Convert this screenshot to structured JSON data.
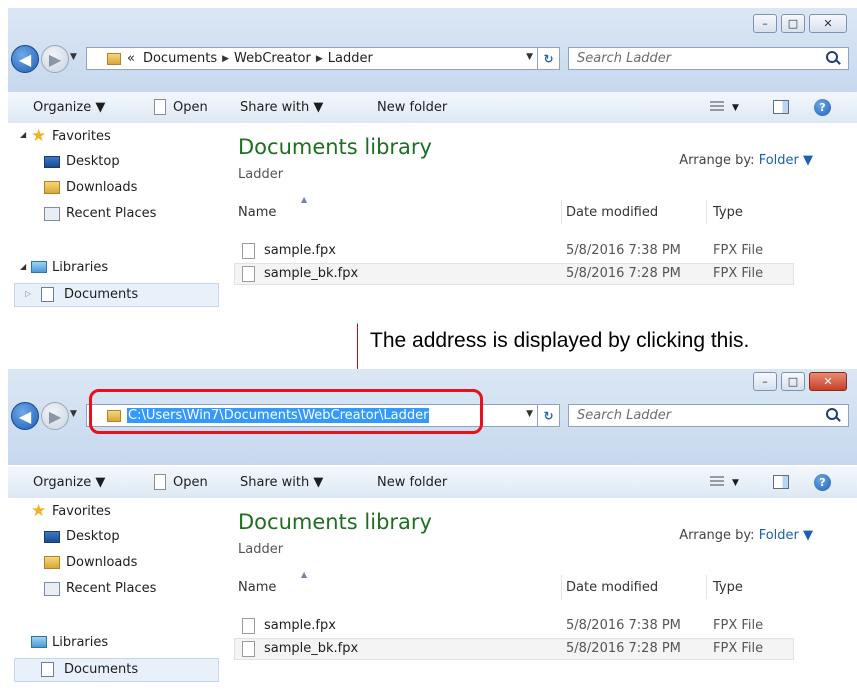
{
  "explorer": {
    "window_controls": {
      "minimize": "–",
      "maximize": "□",
      "close": "✕"
    },
    "nav": {
      "back": "◀",
      "forward": "▶",
      "dropdown": "▼"
    },
    "address": {
      "breadcrumb_prefix": "«",
      "breadcrumb": [
        "Documents",
        "WebCreator",
        "Ladder"
      ],
      "separator": "▶",
      "full_path": "C:\\Users\\Win7\\Documents\\WebCreator\\Ladder",
      "dropdown": "▼",
      "refresh": "↻"
    },
    "search": {
      "placeholder": "Search Ladder"
    },
    "toolbar": {
      "organize": "Organize ▼",
      "open": "Open",
      "share_with": "Share with ▼",
      "new_folder": "New folder",
      "views_dropdown": "▼",
      "help": "?"
    },
    "nav_pane": {
      "favorites": "Favorites",
      "desktop": "Desktop",
      "downloads": "Downloads",
      "recent_places": "Recent Places",
      "libraries": "Libraries",
      "documents": "Documents",
      "expanded_arrow": "◢",
      "collapsed_arrow": "▷"
    },
    "content": {
      "library_title": "Documents library",
      "library_subtitle": "Ladder",
      "arrange_by_label": "Arrange by:",
      "arrange_by_value": "Folder ▼",
      "sort_caret": "▲",
      "columns": {
        "name": "Name",
        "date": "Date modified",
        "type": "Type"
      },
      "files": [
        {
          "name": "sample.fpx",
          "date": "5/8/2016 7:38 PM",
          "type": "FPX File"
        },
        {
          "name": "sample_bk.fpx",
          "date": "5/8/2016 7:28 PM",
          "type": "FPX File"
        }
      ]
    }
  },
  "callout": {
    "text": "The address is displayed by clicking this."
  },
  "colors": {
    "highlight": "#e8101a",
    "selection": "#3399ff",
    "library_title": "#1e6f20"
  }
}
